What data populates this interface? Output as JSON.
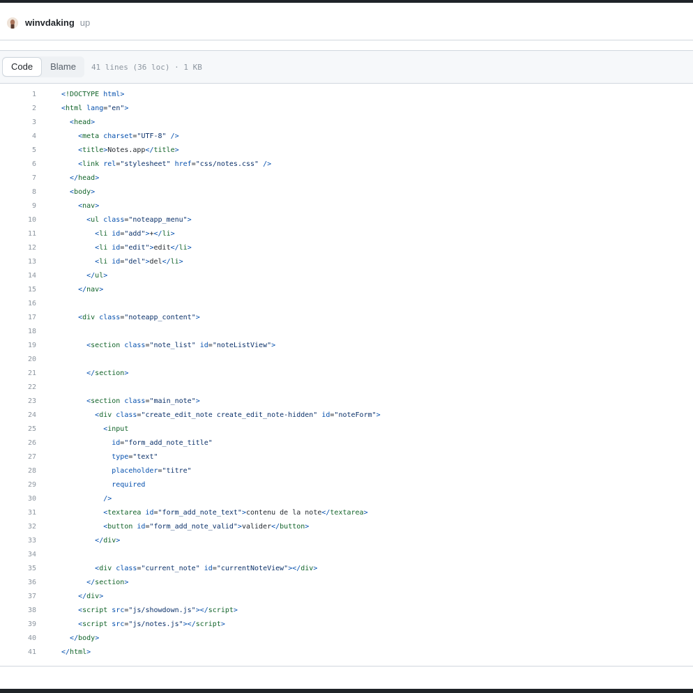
{
  "commit": {
    "author": "winvdaking",
    "message": "up"
  },
  "file_header": {
    "code_tab": "Code",
    "blame_tab": "Blame",
    "info": "41 lines (36 loc) · 1 KB"
  },
  "code_lines": [
    {
      "num": "1",
      "tokens": [
        [
          "p",
          "<"
        ],
        [
          "t",
          "!DOCTYPE"
        ],
        [
          "x",
          " "
        ],
        [
          "a",
          "html"
        ],
        [
          "p",
          ">"
        ]
      ]
    },
    {
      "num": "2",
      "tokens": [
        [
          "p",
          "<"
        ],
        [
          "t",
          "html"
        ],
        [
          "x",
          " "
        ],
        [
          "a",
          "lang"
        ],
        [
          "x",
          "="
        ],
        [
          "s",
          "\"en\""
        ],
        [
          "p",
          ">"
        ]
      ]
    },
    {
      "num": "3",
      "tokens": [
        [
          "x",
          "  "
        ],
        [
          "p",
          "<"
        ],
        [
          "t",
          "head"
        ],
        [
          "p",
          ">"
        ]
      ]
    },
    {
      "num": "4",
      "tokens": [
        [
          "x",
          "    "
        ],
        [
          "p",
          "<"
        ],
        [
          "t",
          "meta"
        ],
        [
          "x",
          " "
        ],
        [
          "a",
          "charset"
        ],
        [
          "x",
          "="
        ],
        [
          "s",
          "\"UTF-8\""
        ],
        [
          "x",
          " "
        ],
        [
          "p",
          "/>"
        ]
      ]
    },
    {
      "num": "5",
      "tokens": [
        [
          "x",
          "    "
        ],
        [
          "p",
          "<"
        ],
        [
          "t",
          "title"
        ],
        [
          "p",
          ">"
        ],
        [
          "x",
          "Notes.app"
        ],
        [
          "p",
          "</"
        ],
        [
          "t",
          "title"
        ],
        [
          "p",
          ">"
        ]
      ]
    },
    {
      "num": "6",
      "tokens": [
        [
          "x",
          "    "
        ],
        [
          "p",
          "<"
        ],
        [
          "t",
          "link"
        ],
        [
          "x",
          " "
        ],
        [
          "a",
          "rel"
        ],
        [
          "x",
          "="
        ],
        [
          "s",
          "\"stylesheet\""
        ],
        [
          "x",
          " "
        ],
        [
          "a",
          "href"
        ],
        [
          "x",
          "="
        ],
        [
          "s",
          "\"css/notes.css\""
        ],
        [
          "x",
          " "
        ],
        [
          "p",
          "/>"
        ]
      ]
    },
    {
      "num": "7",
      "tokens": [
        [
          "x",
          "  "
        ],
        [
          "p",
          "</"
        ],
        [
          "t",
          "head"
        ],
        [
          "p",
          ">"
        ]
      ]
    },
    {
      "num": "8",
      "tokens": [
        [
          "x",
          "  "
        ],
        [
          "p",
          "<"
        ],
        [
          "t",
          "body"
        ],
        [
          "p",
          ">"
        ]
      ]
    },
    {
      "num": "9",
      "tokens": [
        [
          "x",
          "    "
        ],
        [
          "p",
          "<"
        ],
        [
          "t",
          "nav"
        ],
        [
          "p",
          ">"
        ]
      ]
    },
    {
      "num": "10",
      "tokens": [
        [
          "x",
          "      "
        ],
        [
          "p",
          "<"
        ],
        [
          "t",
          "ul"
        ],
        [
          "x",
          " "
        ],
        [
          "a",
          "class"
        ],
        [
          "x",
          "="
        ],
        [
          "s",
          "\"noteapp_menu\""
        ],
        [
          "p",
          ">"
        ]
      ]
    },
    {
      "num": "11",
      "tokens": [
        [
          "x",
          "        "
        ],
        [
          "p",
          "<"
        ],
        [
          "t",
          "li"
        ],
        [
          "x",
          " "
        ],
        [
          "a",
          "id"
        ],
        [
          "x",
          "="
        ],
        [
          "s",
          "\"add\""
        ],
        [
          "p",
          ">"
        ],
        [
          "x",
          "+"
        ],
        [
          "p",
          "</"
        ],
        [
          "t",
          "li"
        ],
        [
          "p",
          ">"
        ]
      ]
    },
    {
      "num": "12",
      "tokens": [
        [
          "x",
          "        "
        ],
        [
          "p",
          "<"
        ],
        [
          "t",
          "li"
        ],
        [
          "x",
          " "
        ],
        [
          "a",
          "id"
        ],
        [
          "x",
          "="
        ],
        [
          "s",
          "\"edit\""
        ],
        [
          "p",
          ">"
        ],
        [
          "x",
          "edit"
        ],
        [
          "p",
          "</"
        ],
        [
          "t",
          "li"
        ],
        [
          "p",
          ">"
        ]
      ]
    },
    {
      "num": "13",
      "tokens": [
        [
          "x",
          "        "
        ],
        [
          "p",
          "<"
        ],
        [
          "t",
          "li"
        ],
        [
          "x",
          " "
        ],
        [
          "a",
          "id"
        ],
        [
          "x",
          "="
        ],
        [
          "s",
          "\"del\""
        ],
        [
          "p",
          ">"
        ],
        [
          "x",
          "del"
        ],
        [
          "p",
          "</"
        ],
        [
          "t",
          "li"
        ],
        [
          "p",
          ">"
        ]
      ]
    },
    {
      "num": "14",
      "tokens": [
        [
          "x",
          "      "
        ],
        [
          "p",
          "</"
        ],
        [
          "t",
          "ul"
        ],
        [
          "p",
          ">"
        ]
      ]
    },
    {
      "num": "15",
      "tokens": [
        [
          "x",
          "    "
        ],
        [
          "p",
          "</"
        ],
        [
          "t",
          "nav"
        ],
        [
          "p",
          ">"
        ]
      ]
    },
    {
      "num": "16",
      "tokens": []
    },
    {
      "num": "17",
      "tokens": [
        [
          "x",
          "    "
        ],
        [
          "p",
          "<"
        ],
        [
          "t",
          "div"
        ],
        [
          "x",
          " "
        ],
        [
          "a",
          "class"
        ],
        [
          "x",
          "="
        ],
        [
          "s",
          "\"noteapp_content\""
        ],
        [
          "p",
          ">"
        ]
      ]
    },
    {
      "num": "18",
      "tokens": []
    },
    {
      "num": "19",
      "tokens": [
        [
          "x",
          "      "
        ],
        [
          "p",
          "<"
        ],
        [
          "t",
          "section"
        ],
        [
          "x",
          " "
        ],
        [
          "a",
          "class"
        ],
        [
          "x",
          "="
        ],
        [
          "s",
          "\"note_list\""
        ],
        [
          "x",
          " "
        ],
        [
          "a",
          "id"
        ],
        [
          "x",
          "="
        ],
        [
          "s",
          "\"noteListView\""
        ],
        [
          "p",
          ">"
        ]
      ]
    },
    {
      "num": "20",
      "tokens": []
    },
    {
      "num": "21",
      "tokens": [
        [
          "x",
          "      "
        ],
        [
          "p",
          "</"
        ],
        [
          "t",
          "section"
        ],
        [
          "p",
          ">"
        ]
      ]
    },
    {
      "num": "22",
      "tokens": []
    },
    {
      "num": "23",
      "tokens": [
        [
          "x",
          "      "
        ],
        [
          "p",
          "<"
        ],
        [
          "t",
          "section"
        ],
        [
          "x",
          " "
        ],
        [
          "a",
          "class"
        ],
        [
          "x",
          "="
        ],
        [
          "s",
          "\"main_note\""
        ],
        [
          "p",
          ">"
        ]
      ]
    },
    {
      "num": "24",
      "tokens": [
        [
          "x",
          "        "
        ],
        [
          "p",
          "<"
        ],
        [
          "t",
          "div"
        ],
        [
          "x",
          " "
        ],
        [
          "a",
          "class"
        ],
        [
          "x",
          "="
        ],
        [
          "s",
          "\"create_edit_note create_edit_note-hidden\""
        ],
        [
          "x",
          " "
        ],
        [
          "a",
          "id"
        ],
        [
          "x",
          "="
        ],
        [
          "s",
          "\"noteForm\""
        ],
        [
          "p",
          ">"
        ]
      ]
    },
    {
      "num": "25",
      "tokens": [
        [
          "x",
          "          "
        ],
        [
          "p",
          "<"
        ],
        [
          "t",
          "input"
        ]
      ]
    },
    {
      "num": "26",
      "tokens": [
        [
          "x",
          "            "
        ],
        [
          "a",
          "id"
        ],
        [
          "x",
          "="
        ],
        [
          "s",
          "\"form_add_note_title\""
        ]
      ]
    },
    {
      "num": "27",
      "tokens": [
        [
          "x",
          "            "
        ],
        [
          "a",
          "type"
        ],
        [
          "x",
          "="
        ],
        [
          "s",
          "\"text\""
        ]
      ]
    },
    {
      "num": "28",
      "tokens": [
        [
          "x",
          "            "
        ],
        [
          "a",
          "placeholder"
        ],
        [
          "x",
          "="
        ],
        [
          "s",
          "\"titre\""
        ]
      ]
    },
    {
      "num": "29",
      "tokens": [
        [
          "x",
          "            "
        ],
        [
          "a",
          "required"
        ]
      ]
    },
    {
      "num": "30",
      "tokens": [
        [
          "x",
          "          "
        ],
        [
          "p",
          "/>"
        ]
      ]
    },
    {
      "num": "31",
      "tokens": [
        [
          "x",
          "          "
        ],
        [
          "p",
          "<"
        ],
        [
          "t",
          "textarea"
        ],
        [
          "x",
          " "
        ],
        [
          "a",
          "id"
        ],
        [
          "x",
          "="
        ],
        [
          "s",
          "\"form_add_note_text\""
        ],
        [
          "p",
          ">"
        ],
        [
          "x",
          "contenu de la note"
        ],
        [
          "p",
          "</"
        ],
        [
          "t",
          "textarea"
        ],
        [
          "p",
          ">"
        ]
      ]
    },
    {
      "num": "32",
      "tokens": [
        [
          "x",
          "          "
        ],
        [
          "p",
          "<"
        ],
        [
          "t",
          "button"
        ],
        [
          "x",
          " "
        ],
        [
          "a",
          "id"
        ],
        [
          "x",
          "="
        ],
        [
          "s",
          "\"form_add_note_valid\""
        ],
        [
          "p",
          ">"
        ],
        [
          "x",
          "valider"
        ],
        [
          "p",
          "</"
        ],
        [
          "t",
          "button"
        ],
        [
          "p",
          ">"
        ]
      ]
    },
    {
      "num": "33",
      "tokens": [
        [
          "x",
          "        "
        ],
        [
          "p",
          "</"
        ],
        [
          "t",
          "div"
        ],
        [
          "p",
          ">"
        ]
      ]
    },
    {
      "num": "34",
      "tokens": []
    },
    {
      "num": "35",
      "tokens": [
        [
          "x",
          "        "
        ],
        [
          "p",
          "<"
        ],
        [
          "t",
          "div"
        ],
        [
          "x",
          " "
        ],
        [
          "a",
          "class"
        ],
        [
          "x",
          "="
        ],
        [
          "s",
          "\"current_note\""
        ],
        [
          "x",
          " "
        ],
        [
          "a",
          "id"
        ],
        [
          "x",
          "="
        ],
        [
          "s",
          "\"currentNoteView\""
        ],
        [
          "p",
          "></"
        ],
        [
          "t",
          "div"
        ],
        [
          "p",
          ">"
        ]
      ]
    },
    {
      "num": "36",
      "tokens": [
        [
          "x",
          "      "
        ],
        [
          "p",
          "</"
        ],
        [
          "t",
          "section"
        ],
        [
          "p",
          ">"
        ]
      ]
    },
    {
      "num": "37",
      "tokens": [
        [
          "x",
          "    "
        ],
        [
          "p",
          "</"
        ],
        [
          "t",
          "div"
        ],
        [
          "p",
          ">"
        ]
      ]
    },
    {
      "num": "38",
      "tokens": [
        [
          "x",
          "    "
        ],
        [
          "p",
          "<"
        ],
        [
          "t",
          "script"
        ],
        [
          "x",
          " "
        ],
        [
          "a",
          "src"
        ],
        [
          "x",
          "="
        ],
        [
          "s",
          "\"js/showdown.js\""
        ],
        [
          "p",
          "></"
        ],
        [
          "t",
          "script"
        ],
        [
          "p",
          ">"
        ]
      ]
    },
    {
      "num": "39",
      "tokens": [
        [
          "x",
          "    "
        ],
        [
          "p",
          "<"
        ],
        [
          "t",
          "script"
        ],
        [
          "x",
          " "
        ],
        [
          "a",
          "src"
        ],
        [
          "x",
          "="
        ],
        [
          "s",
          "\"js/notes.js\""
        ],
        [
          "p",
          "></"
        ],
        [
          "t",
          "script"
        ],
        [
          "p",
          ">"
        ]
      ]
    },
    {
      "num": "40",
      "tokens": [
        [
          "x",
          "  "
        ],
        [
          "p",
          "</"
        ],
        [
          "t",
          "body"
        ],
        [
          "p",
          ">"
        ]
      ]
    },
    {
      "num": "41",
      "tokens": [
        [
          "p",
          "</"
        ],
        [
          "t",
          "html"
        ],
        [
          "p",
          ">"
        ]
      ]
    }
  ],
  "colors": {
    "tag": "#116329",
    "attr": "#0550ae",
    "string": "#0a3069",
    "text": "#24292f",
    "line_number": "#8c959f"
  }
}
